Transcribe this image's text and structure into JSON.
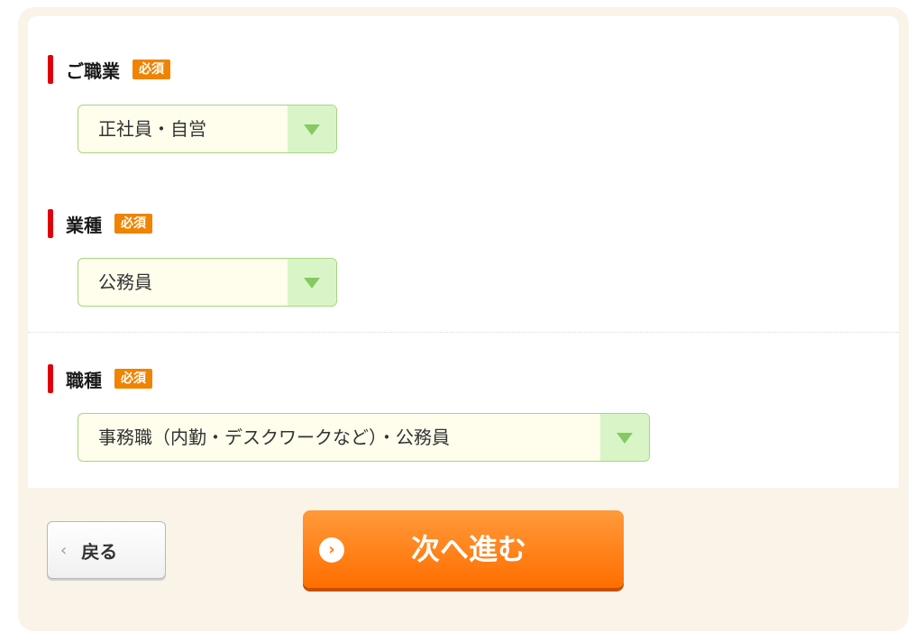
{
  "form": {
    "required_badge": "必須",
    "occupation": {
      "label": "ご職業",
      "value": "正社員・自営"
    },
    "industry": {
      "label": "業種",
      "value": "公務員"
    },
    "job_type": {
      "label": "職種",
      "value": "事務職（内勤・デスクワークなど）・公務員"
    }
  },
  "footer": {
    "back_label": "戻る",
    "back_icon": "chevron-left-icon",
    "next_label": "次へ進む",
    "next_icon": "chevron-right-circle-icon"
  },
  "colors": {
    "accent_red": "#e0000d",
    "badge_orange": "#f08300",
    "select_border_green": "#a5d77d",
    "next_button_orange": "#ff7a10",
    "panel_beige": "#f9f3e8"
  }
}
